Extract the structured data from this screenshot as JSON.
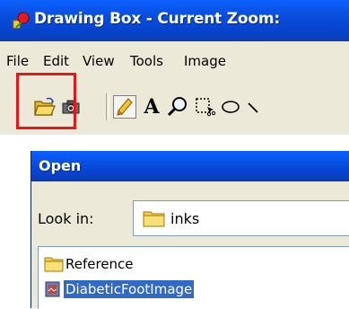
{
  "app": {
    "title": "Drawing Box - Current Zoom:",
    "menu": [
      "File",
      "Edit",
      "View",
      "Tools",
      "Image"
    ]
  },
  "toolbar": {
    "tools": [
      "open-folder-icon",
      "camera-icon",
      "pencil-icon",
      "text-icon",
      "zoom-icon",
      "select-icon",
      "ellipse-icon"
    ],
    "text_tool_glyph": "A",
    "highlight_color": "#e8161b"
  },
  "dialog": {
    "title": "Open",
    "look_in_label": "Look in:",
    "look_in_value": "inks",
    "files": [
      {
        "name": "Reference",
        "icon": "folder-icon",
        "selected": false
      },
      {
        "name": "DiabeticFootImage",
        "icon": "ink-file-icon",
        "selected": true
      }
    ]
  },
  "colors": {
    "titlebar": "#0a4fe0",
    "window_bg": "#ece9d8",
    "selection": "#316ac5"
  }
}
